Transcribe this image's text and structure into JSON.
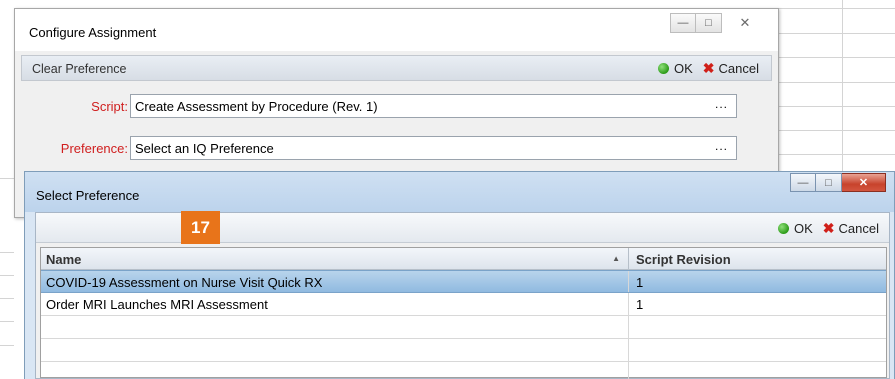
{
  "configure_window": {
    "title": "Configure Assignment",
    "toolbar_label": "Clear Preference",
    "ok_label": "OK",
    "cancel_label": "Cancel",
    "script_label": "Script:",
    "script_value": "Create Assessment by Procedure (Rev. 1)",
    "preference_label": "Preference:",
    "preference_value": "Select an IQ Preference",
    "browse_label": "..."
  },
  "select_window": {
    "title": "Select Preference",
    "ok_label": "OK",
    "cancel_label": "Cancel",
    "columns": [
      "Name",
      "Script Revision"
    ],
    "rows": [
      {
        "name": "COVID-19 Assessment on Nurse Visit Quick RX",
        "revision": "1",
        "selected": true
      },
      {
        "name": "Order MRI Launches MRI Assessment",
        "revision": "1",
        "selected": false
      }
    ]
  },
  "callout_badge": "17",
  "colors": {
    "badge": "#e8741a",
    "label_red": "#d01e1e",
    "selection": "#90bae0"
  }
}
